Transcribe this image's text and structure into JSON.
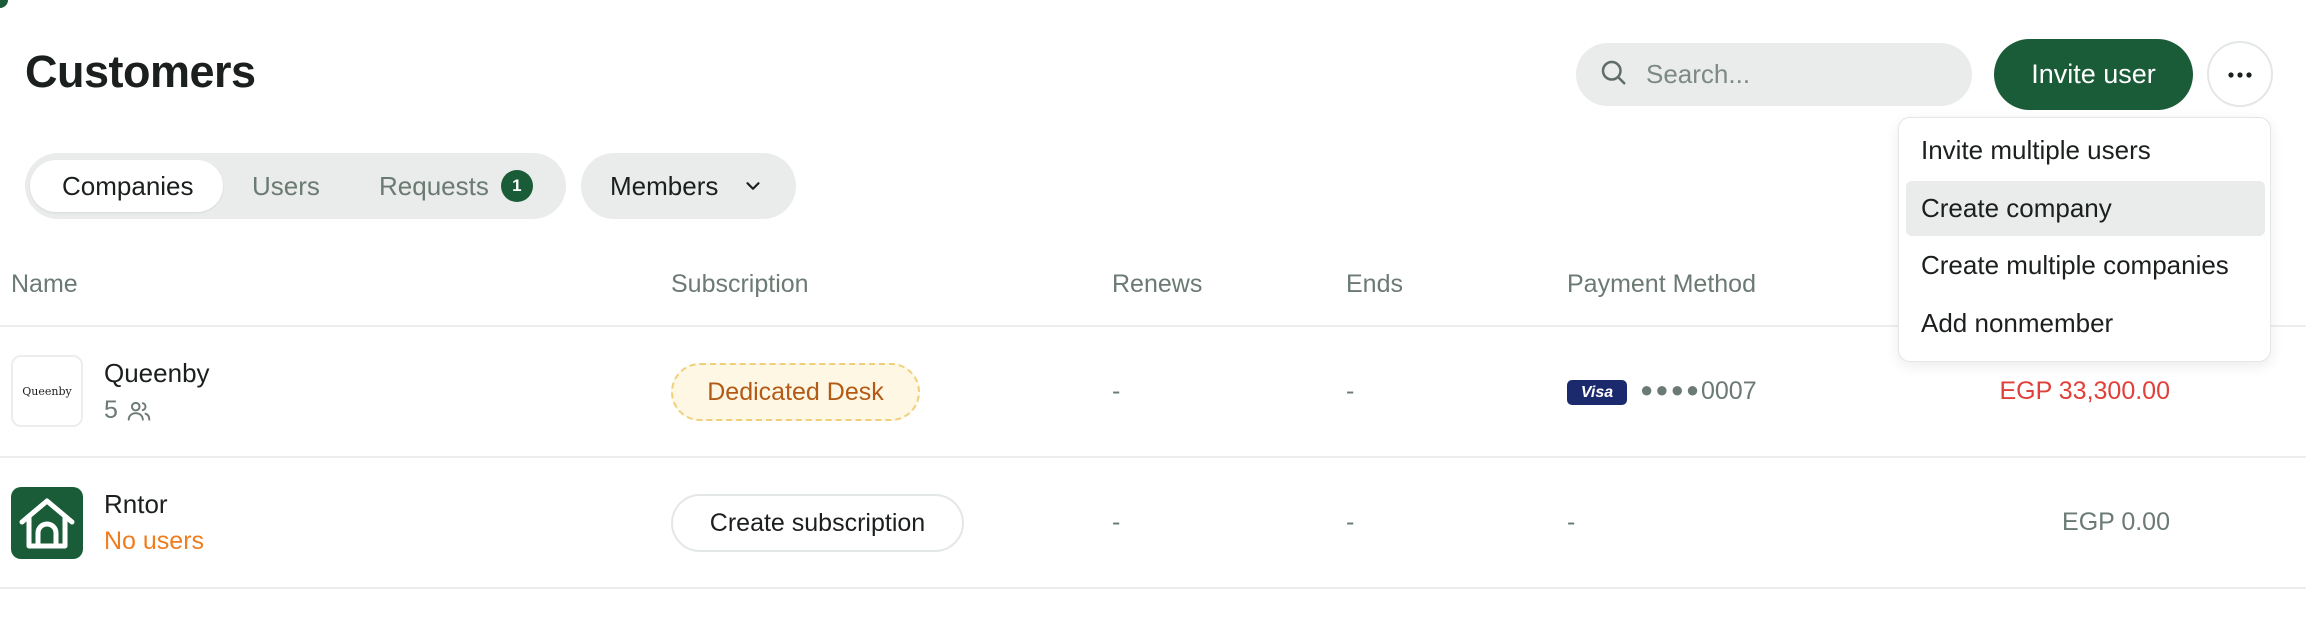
{
  "page": {
    "title": "Customers"
  },
  "search": {
    "placeholder": "Search..."
  },
  "header": {
    "invite_label": "Invite user",
    "more_icon": "ellipsis-icon"
  },
  "tabs": {
    "items": [
      {
        "label": "Companies",
        "active": true
      },
      {
        "label": "Users",
        "active": false
      },
      {
        "label": "Requests",
        "active": false,
        "badge": "1"
      }
    ]
  },
  "filter": {
    "members_label": "Members"
  },
  "table": {
    "headers": [
      "Name",
      "Subscription",
      "Renews",
      "Ends",
      "Payment Method"
    ],
    "rows": [
      {
        "name": "Queenby",
        "logo_text": "Queenby",
        "users": "5",
        "subscription": "Dedicated Desk",
        "renews": "-",
        "ends": "-",
        "card_brand": "Visa",
        "card_dots": "●●●●",
        "card_last4": "0007",
        "amount": "EGP 33,300.00",
        "amount_color": "#e0403a"
      },
      {
        "name": "Rntor",
        "users_text": "No users",
        "users_color": "#ef7d1f",
        "subscription_action": "Create subscription",
        "renews": "-",
        "ends": "-",
        "payment": "-",
        "amount": "EGP 0.00",
        "amount_color": "#6b7a73"
      }
    ]
  },
  "menu": {
    "items": [
      {
        "label": "Invite multiple users"
      },
      {
        "label": "Create company",
        "highlighted": true
      },
      {
        "label": "Create multiple companies"
      },
      {
        "label": "Add nonmember"
      }
    ]
  },
  "colors": {
    "brand": "#1a5c38",
    "muted": "#6b7a73",
    "surface": "#e9ecea"
  }
}
